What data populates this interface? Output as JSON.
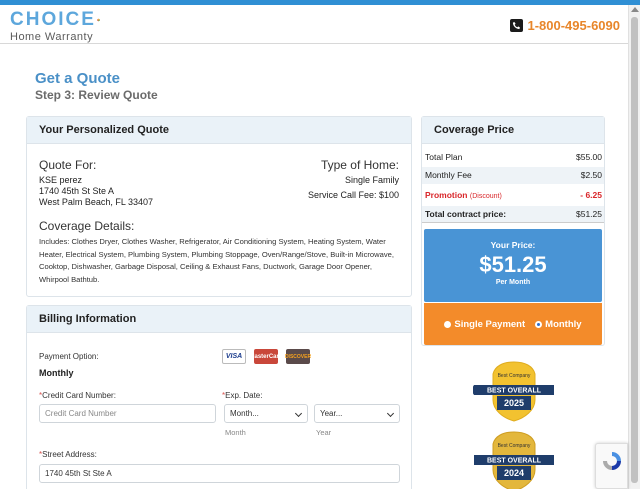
{
  "header": {
    "logo_text": "CHOICE",
    "logo_sub": "Home Warranty",
    "phone": "1-800-495-6090"
  },
  "page": {
    "title": "Get a Quote",
    "step": "Step 3: Review Quote"
  },
  "quote": {
    "heading": "Your Personalized Quote",
    "quote_for_label": "Quote For:",
    "name": "KSE perez",
    "street": "1740 45th St Ste A",
    "city": "West Palm Beach, FL 33407",
    "type_label": "Type of Home:",
    "type_value": "Single Family",
    "service_fee": "Service Call Fee: $100",
    "coverage_label": "Coverage Details:",
    "coverage_text": "Includes: Clothes Dryer, Clothes Washer, Refrigerator, Air Conditioning System, Heating System, Water Heater, Electrical System, Plumbing System, Plumbing Stoppage, Oven/Range/Stove, Built-in Microwave, Cooktop, Dishwasher, Garbage Disposal, Ceiling & Exhaust Fans, Ductwork, Garage Door Opener, Whirpool Bathtub."
  },
  "billing": {
    "heading": "Billing Information",
    "payment_option_label": "Payment Option:",
    "payment_option_value": "Monthly",
    "cards": {
      "visa": "VISA",
      "mastercard": "MasterCard",
      "discover": "DISCOVER"
    },
    "cc_label": "Credit Card Number:",
    "cc_placeholder": "Credit Card Number",
    "exp_label": "Exp. Date:",
    "month_placeholder": "Month...",
    "year_placeholder": "Year...",
    "month_hint": "Month",
    "year_hint": "Year",
    "street_label": "Street Address:",
    "street_value": "1740 45th St Ste A"
  },
  "coverage_price": {
    "heading": "Coverage Price",
    "total_plan_label": "Total Plan",
    "total_plan_value": "$55.00",
    "monthly_fee_label": "Monthly Fee",
    "monthly_fee_value": "$2.50",
    "promotion_label": "Promotion",
    "promotion_note": "(Discount)",
    "promotion_value": "- 6.25",
    "total_contract_label": "Total contract price:",
    "total_contract_value": "$51.25",
    "your_price_label": "Your Price:",
    "your_price_value": "$51.25",
    "per_label": "Per Month",
    "single_payment": "Single Payment",
    "monthly": "Monthly",
    "selected_payment": "Monthly"
  },
  "badges": [
    {
      "top": "Best Company",
      "main": "BEST OVERALL",
      "year": "2025"
    },
    {
      "top": "Best Company",
      "main": "BEST OVERALL",
      "year": "2024"
    }
  ],
  "colors": {
    "accent_blue": "#4994d5",
    "accent_orange": "#f38b2a",
    "promo_red": "#d9262a",
    "title_blue": "#4a90c7"
  }
}
